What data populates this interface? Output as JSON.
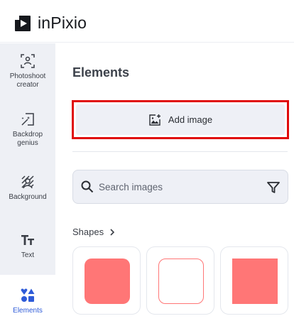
{
  "app": {
    "name": "inPixio",
    "logo_icon": "play-logo-icon"
  },
  "sidebar": {
    "items": [
      {
        "label": "Photoshoot creator",
        "icon": "photoshoot-icon"
      },
      {
        "label": "Backdrop genius",
        "icon": "magic-wand-icon"
      },
      {
        "label": "Background",
        "icon": "background-icon"
      },
      {
        "label": "Text",
        "icon": "text-icon"
      },
      {
        "label": "Elements",
        "icon": "elements-icon",
        "active": true
      }
    ]
  },
  "panel": {
    "title": "Elements",
    "add_image": {
      "label": "Add image",
      "icon": "add-image-icon"
    },
    "search": {
      "placeholder": "Search images",
      "value": ""
    },
    "shapes": {
      "label": "Shapes",
      "items": [
        "rounded-square",
        "outline-rounded-square",
        "square"
      ]
    }
  },
  "colors": {
    "accent": "#2e5bd8",
    "highlight": "#e00b0b",
    "shape": "#ff7676",
    "sidebar_bg": "#eef0f5"
  }
}
